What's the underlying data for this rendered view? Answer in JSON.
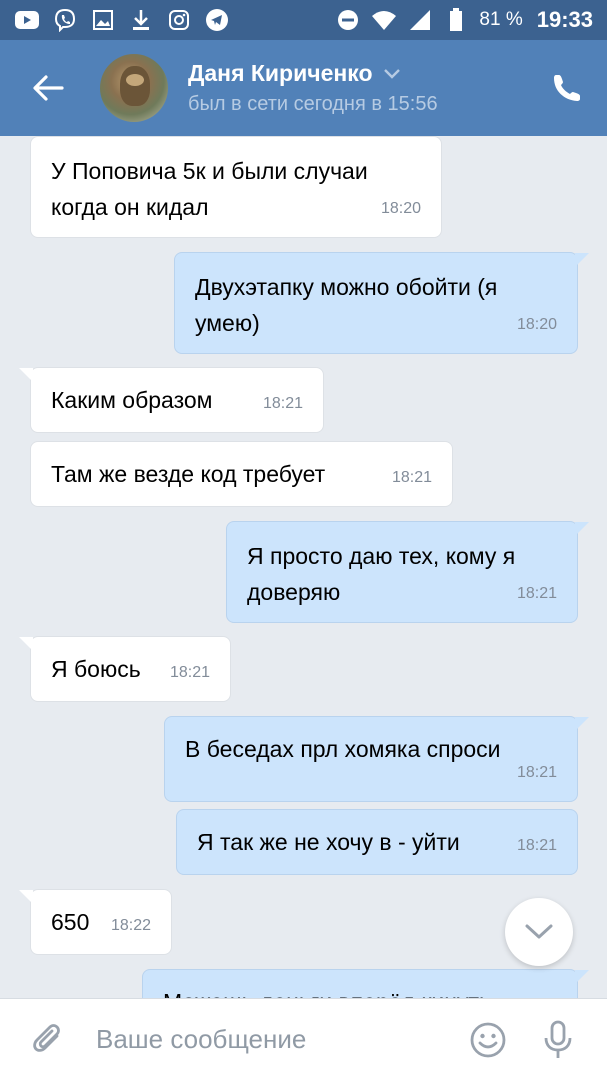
{
  "status_bar": {
    "left_icons": [
      "youtube-icon",
      "viber-icon",
      "gallery-icon",
      "download-icon",
      "instagram-icon",
      "telegram-icon"
    ],
    "right_icons": [
      "do-not-disturb-icon",
      "wifi-icon",
      "signal-icon",
      "battery-icon"
    ],
    "battery": "81 %",
    "time": "19:33"
  },
  "header": {
    "name": "Даня Кириченко",
    "status": "был в сети сегодня в 15:56",
    "accent_color": "#5181b8"
  },
  "messages": [
    {
      "direction": "in",
      "text": "У Поповича 5к и были случаи когда он кидал",
      "time": "18:20"
    },
    {
      "direction": "out",
      "text": "Двухэтапку можно обойти (я умею)",
      "time": "18:20"
    },
    {
      "direction": "in",
      "text": "Каким образом",
      "time": "18:21"
    },
    {
      "direction": "in",
      "text": "Там же везде код требует",
      "time": "18:21"
    },
    {
      "direction": "out",
      "text": "Я просто даю тех, кому я доверяю",
      "time": "18:21"
    },
    {
      "direction": "in",
      "text": "Я боюсь",
      "time": "18:21"
    },
    {
      "direction": "out",
      "text": "В беседах прл хомяка спроси",
      "time": "18:21"
    },
    {
      "direction": "out",
      "text": "Я так же не хочу в - уйти",
      "time": "18:21"
    },
    {
      "direction": "in",
      "text": "650",
      "time": "18:22"
    },
    {
      "direction": "out",
      "text": "Можешь деньги вперёд кинуть",
      "time": ""
    }
  ],
  "composer": {
    "placeholder": "Ваше сообщение"
  },
  "colors": {
    "status_bar": "#3c6290",
    "header": "#5181b8",
    "background": "#e7ebf0",
    "incoming_bubble": "#ffffff",
    "outgoing_bubble": "#cce4fc"
  }
}
